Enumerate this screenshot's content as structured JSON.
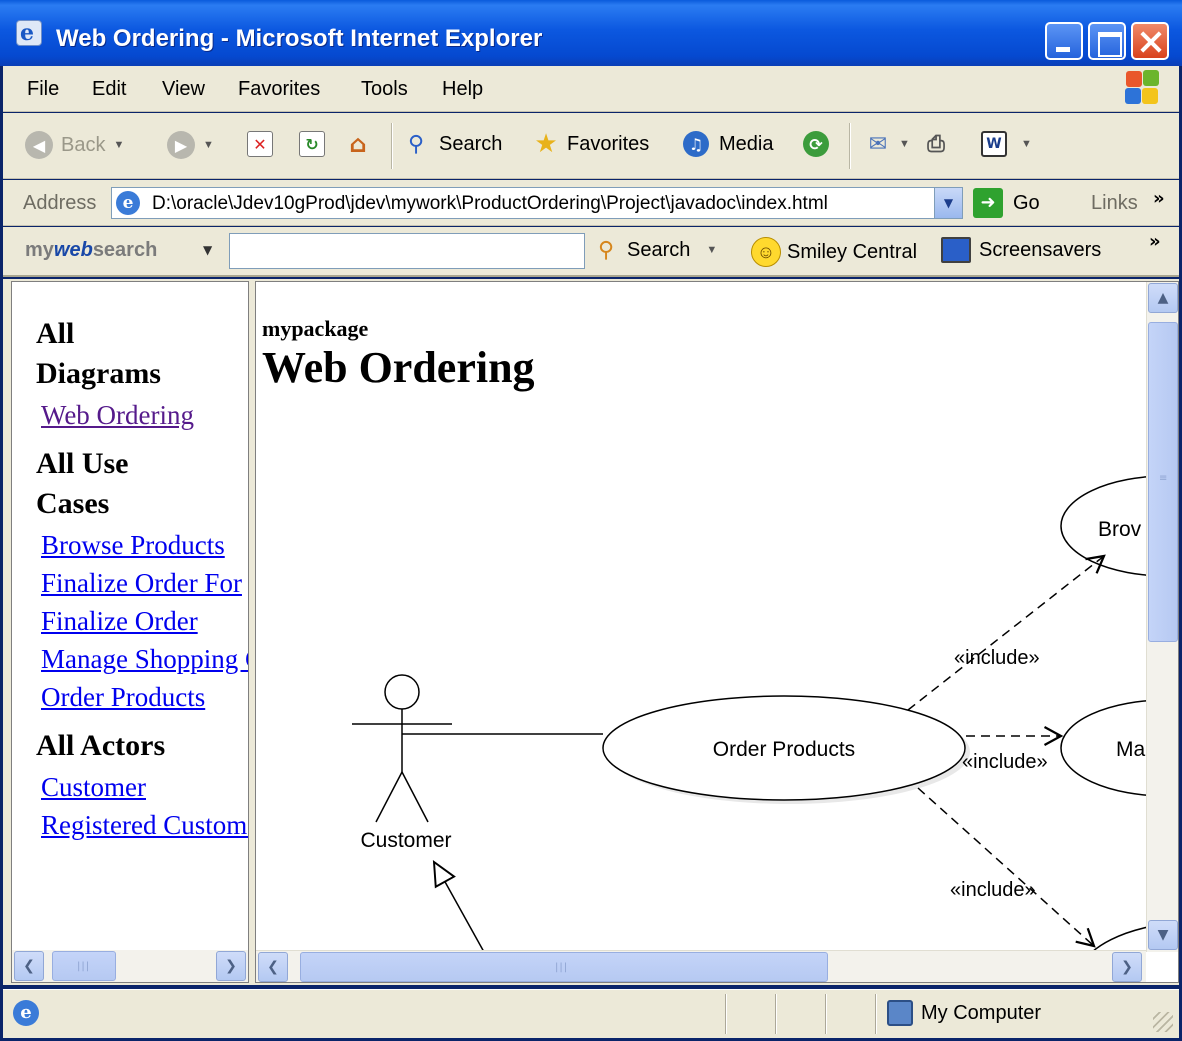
{
  "window": {
    "title": "Web Ordering - Microsoft Internet Explorer"
  },
  "menu": [
    "File",
    "Edit",
    "View",
    "Favorites",
    "Tools",
    "Help"
  ],
  "toolbar": {
    "back": "Back",
    "search": "Search",
    "favorites": "Favorites",
    "media": "Media"
  },
  "address": {
    "label": "Address",
    "url": "D:\\oracle\\Jdev10gProd\\jdev\\mywork\\ProductOrdering\\Project\\javadoc\\index.html",
    "go": "Go",
    "links": "Links"
  },
  "searchbar": {
    "brand_prefix": "my",
    "brand_web": "web",
    "brand_suffix": "search",
    "input_value": "",
    "search": "Search",
    "smiley": "Smiley Central",
    "screensavers": "Screensavers"
  },
  "left_frame": {
    "all_diagrams": [
      "All",
      "Diagrams"
    ],
    "diagram_links": [
      "Web Ordering"
    ],
    "all_use_cases": [
      "All Use",
      "Cases"
    ],
    "use_case_links": [
      "Browse Products",
      "Finalize Order For",
      "Finalize Order",
      "Manage Shopping Cart",
      "Order Products"
    ],
    "all_actors": "All Actors",
    "actor_links": [
      "Customer",
      "Registered Customer"
    ]
  },
  "main": {
    "package": "mypackage",
    "title": "Web Ordering"
  },
  "diagram": {
    "actor": "Customer",
    "center_use_case": "Order Products",
    "browse_partial": "Brov",
    "manage_partial": "Ma",
    "include_label": "«include»"
  },
  "status": {
    "zone": "My Computer"
  },
  "colors": {
    "titlebar": "#0549d0",
    "chrome": "#ece9d8",
    "link": "#0000ee",
    "visited_link": "#551a8b"
  }
}
